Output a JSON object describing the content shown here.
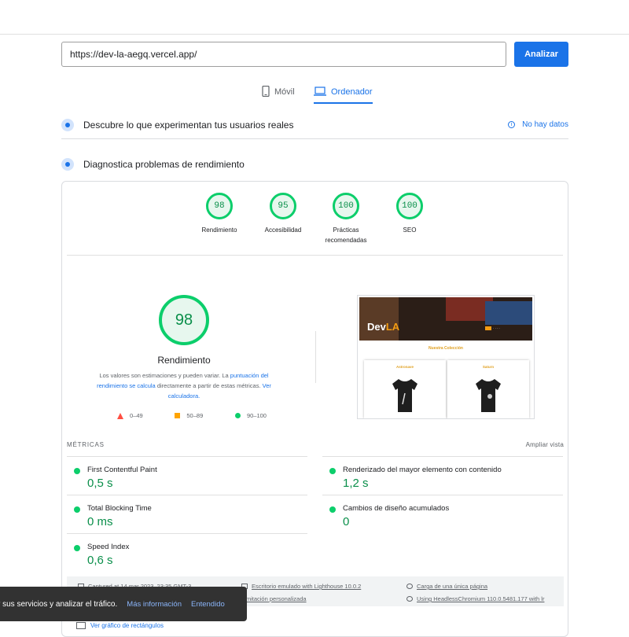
{
  "url_bar": {
    "value": "https://dev-la-aegq.vercel.app/",
    "button": "Analizar"
  },
  "tabs": [
    {
      "label": "Móvil",
      "icon": "phone-icon",
      "selected": false
    },
    {
      "label": "Ordenador",
      "icon": "laptop-icon",
      "selected": true
    }
  ],
  "field_data": {
    "title": "Descubre lo que experimentan tus usuarios reales",
    "status": "No hay datos"
  },
  "lab_data": {
    "title": "Diagnostica problemas de rendimiento"
  },
  "scores": [
    {
      "value": "98",
      "label": "Rendimiento"
    },
    {
      "value": "95",
      "label": "Accesibilidad"
    },
    {
      "value": "100",
      "label": "Prácticas recomendadas"
    },
    {
      "value": "100",
      "label": "SEO"
    }
  ],
  "performance": {
    "score": "98",
    "title": "Rendimiento",
    "desc_a": "Los valores son estimaciones y pueden variar. La ",
    "desc_link1": "puntuación del rendimiento se calcula",
    "desc_b": " directamente a partir de estas métricas. ",
    "desc_link2": "Ver calculadora.",
    "legend": [
      "0–49",
      "50–89",
      "90–100"
    ]
  },
  "screenshot": {
    "logo_a": "Dev",
    "logo_b": "LA",
    "collection": "Nuestra Colección",
    "products": [
      "Astronave",
      "Saturn"
    ]
  },
  "metrics_header": {
    "title": "MÉTRICAS",
    "expand": "Ampliar vista"
  },
  "metrics": [
    {
      "name": "First Contentful Paint",
      "value": "0,5 s"
    },
    {
      "name": "Renderizado del mayor elemento con contenido",
      "value": "1,2 s"
    },
    {
      "name": "Total Blocking Time",
      "value": "0 ms"
    },
    {
      "name": "Cambios de diseño acumulados",
      "value": "0"
    },
    {
      "name": "Speed Index",
      "value": "0,6 s"
    }
  ],
  "run_info": {
    "captured": "Captured at 14 mar 2023, 23:35 GMT-3",
    "emulated": "Escritorio emulado with Lighthouse 10.0.2",
    "load": "Carga de una única página",
    "throttling": "Limitación personalizada",
    "browser": "Using HeadlessChromium 110.0.5481.177 with lr"
  },
  "treemap_link": "Ver gráfico de rectángulos",
  "cookie_toast": {
    "message": "r sus servicios y analizar el tráfico.",
    "more": "Más información",
    "ok": "Entendido"
  },
  "colors": {
    "accent": "#1a73e8",
    "pass": "#0cce6b",
    "average": "#ffa400",
    "fail": "#ff4e42"
  }
}
